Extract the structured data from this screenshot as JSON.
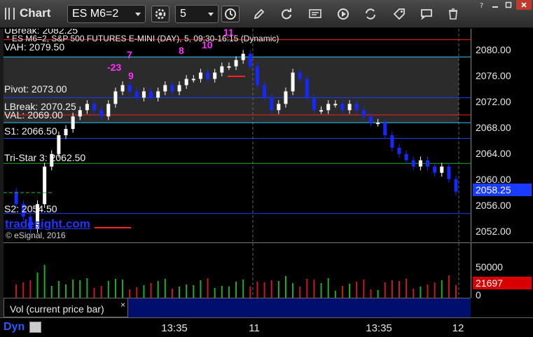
{
  "toolbar": {
    "app_title": "Chart",
    "symbol": "ES M6=2",
    "interval": "5",
    "icons": [
      "settings-icon",
      "clock-icon",
      "pencil-icon",
      "refresh-icon",
      "get-icon",
      "play-icon",
      "tag-icon",
      "comment-icon",
      "trash-icon"
    ]
  },
  "window": {
    "controls": [
      "help-icon",
      "minimize-icon",
      "restore-icon",
      "close-icon"
    ]
  },
  "chart": {
    "header": "* ES M6=2, S&P 500 FUTURES E-MINI (DAY), 5, 09:30-16:15 (Dynamic)",
    "top_partial_label": "UBreak: 2082.25",
    "watermark": "tradesight.com",
    "copyright": "© eSignal, 2016",
    "colors": {
      "up": "#ffffff",
      "down": "#1428ff",
      "grid": "#3a3a3a",
      "bg": "#000000"
    },
    "levels": [
      {
        "name": "UBreak",
        "label": "UBreak: 2082.25",
        "value": 2082.25,
        "color": "#ff2020"
      },
      {
        "name": "VAH",
        "label": "VAH: 2079.50",
        "value": 2079.5,
        "color": "#30c8ff"
      },
      {
        "name": "Pivot",
        "label": "Pivot: 2073.00",
        "value": 2073.0,
        "color": "#1e3cff"
      },
      {
        "name": "LBreak",
        "label": "LBreak: 2070.25",
        "value": 2070.25,
        "color": "#ff2020"
      },
      {
        "name": "VAL",
        "label": "VAL: 2069.00",
        "value": 2069.0,
        "color": "#30c8ff"
      },
      {
        "name": "S1",
        "label": "S1: 2066.50",
        "value": 2066.5,
        "color": "#1e3cff"
      },
      {
        "name": "TriStar",
        "label": "Tri-Star 3: 2062.50",
        "value": 2062.5,
        "color": "#20b020"
      },
      {
        "name": "S2",
        "label": "S2: 2054.50",
        "value": 2054.5,
        "color": "#1e3cff"
      }
    ],
    "price_axis": [
      "2080.00",
      "2076.00",
      "2072.00",
      "2068.00",
      "2064.00",
      "2060.00",
      "2056.00",
      "2052.00"
    ],
    "last_price": "2058.25",
    "annotations": [
      "-23",
      "7",
      "8",
      "10",
      "11",
      "9"
    ],
    "volume": {
      "label": "Vol (current price bar)",
      "close": "×",
      "axis": [
        "50000",
        "0"
      ],
      "last_volume": "21697"
    },
    "time_axis": [
      "13:35",
      "11",
      "13:35",
      "12"
    ]
  },
  "status": {
    "mode": "Dyn"
  },
  "chart_data": {
    "type": "candlestick",
    "symbol": "ES M6=2",
    "interval": "5",
    "ylim": [
      2050,
      2084
    ],
    "grid": false,
    "x": [
      "13:35",
      "11",
      "13:35",
      "12"
    ],
    "series": [
      {
        "values": [
          2058,
          2056,
          2054,
          2052,
          2056,
          2062,
          2064,
          2067,
          2068,
          2070,
          2071,
          2072,
          2071,
          2070,
          2072,
          2074,
          2075,
          2074,
          2073,
          2074,
          2073,
          2074,
          2075,
          2074,
          2075,
          2076,
          2076,
          2077,
          2076,
          2077,
          2078,
          2078,
          2079,
          2080,
          2078,
          2075,
          2073,
          2071,
          2072,
          2074,
          2077,
          2076,
          2073,
          2071,
          2071,
          2072,
          2072,
          2071,
          2072,
          2071,
          2070,
          2069,
          2069,
          2067,
          2065,
          2064,
          2063,
          2062,
          2063,
          2062,
          2061,
          2062,
          2060,
          2058
        ]
      }
    ]
  }
}
